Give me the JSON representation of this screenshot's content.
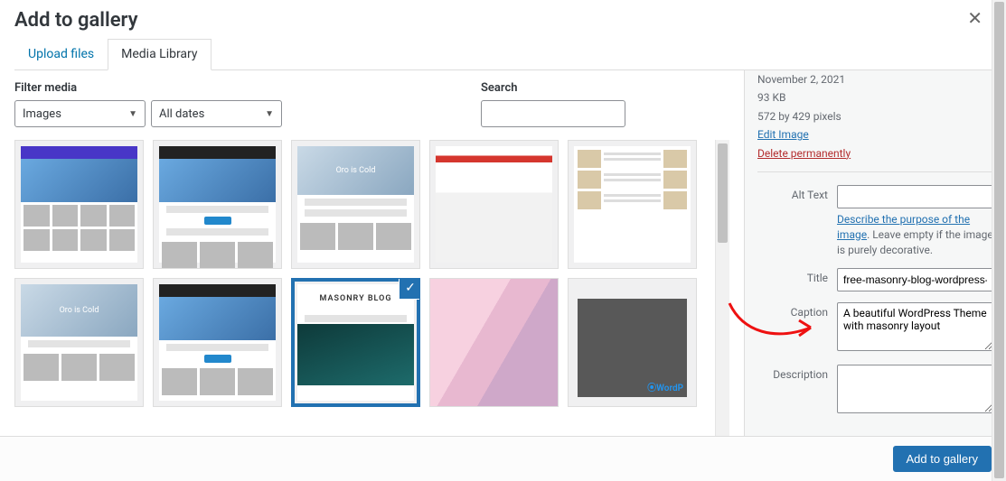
{
  "title": "Add to gallery",
  "tabs": {
    "upload": "Upload files",
    "media": "Media Library",
    "active": "media"
  },
  "filters": {
    "label": "Filter media",
    "type_value": "Images",
    "date_value": "All dates"
  },
  "search": {
    "label": "Search",
    "value": ""
  },
  "thumbnails": [
    {
      "selected": false
    },
    {
      "selected": false
    },
    {
      "selected": false
    },
    {
      "selected": false
    },
    {
      "selected": false
    },
    {
      "selected": false
    },
    {
      "selected": false
    },
    {
      "selected": true
    },
    {
      "selected": false
    },
    {
      "selected": false
    }
  ],
  "details": {
    "date": "November 2, 2021",
    "size": "93 KB",
    "dimensions": "572 by 429 pixels",
    "edit_label": "Edit Image",
    "delete_label": "Delete permanently",
    "alt_label": "Alt Text",
    "alt_value": "",
    "alt_help_link": "Describe the purpose of the image",
    "alt_help_rest": ". Leave empty if the image is purely decorative.",
    "title_label": "Title",
    "title_value": "free-masonry-blog-wordpress-theme",
    "caption_label": "Caption",
    "caption_value": "A beautiful WordPress Theme with masonry layout",
    "description_label": "Description",
    "description_value": ""
  },
  "footer": {
    "submit": "Add to gallery"
  }
}
